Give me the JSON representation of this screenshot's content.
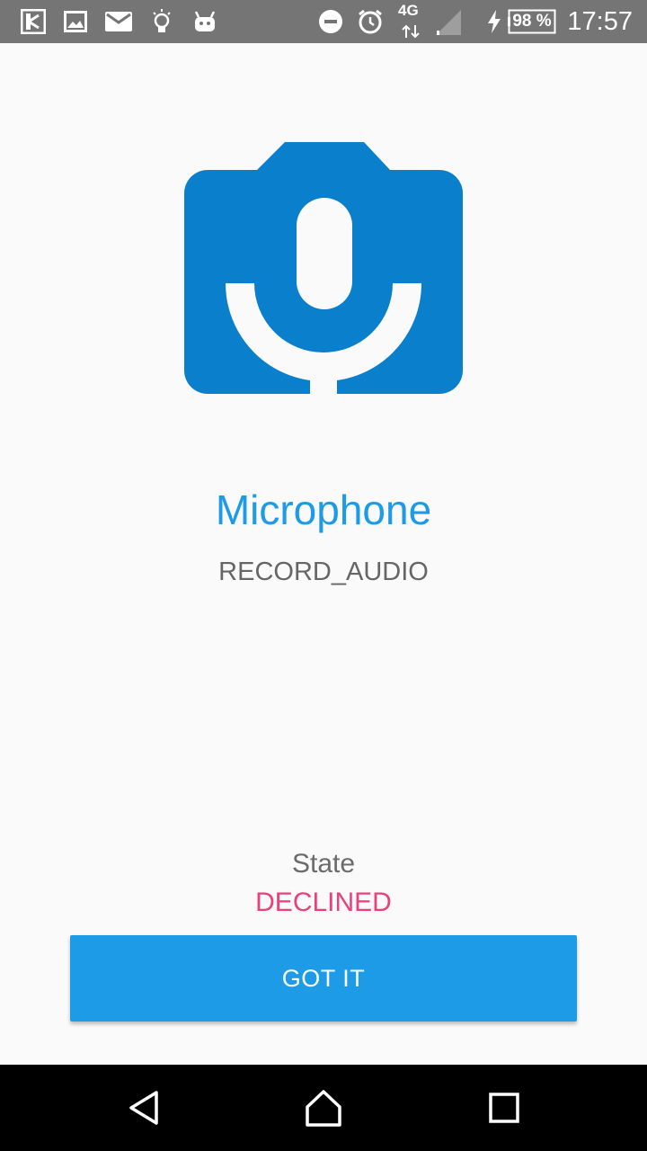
{
  "status_bar": {
    "icons": [
      "flipboard-icon",
      "image-icon",
      "mail-icon",
      "lightbulb-icon",
      "android-icon"
    ],
    "right_icons": [
      "do-not-disturb-icon",
      "alarm-icon",
      "network-4g-icon",
      "signal-icon",
      "charging-icon",
      "battery-icon"
    ],
    "network": "4G",
    "battery": "98 %",
    "time": "17:57"
  },
  "permission": {
    "icon": "microphone-camera-icon",
    "title": "Microphone",
    "name": "RECORD_AUDIO"
  },
  "state": {
    "label": "State",
    "value": "DECLINED"
  },
  "button": {
    "label": "GOT IT"
  },
  "navigation": {
    "buttons": [
      "back-icon",
      "home-icon",
      "recents-icon"
    ]
  },
  "colors": {
    "accent": "#1e9be6",
    "icon_blue": "#0a7fcc",
    "declined": "#ec407a",
    "status_bar": "#757575",
    "nav_bar": "#000000",
    "background": "#fafafa"
  }
}
